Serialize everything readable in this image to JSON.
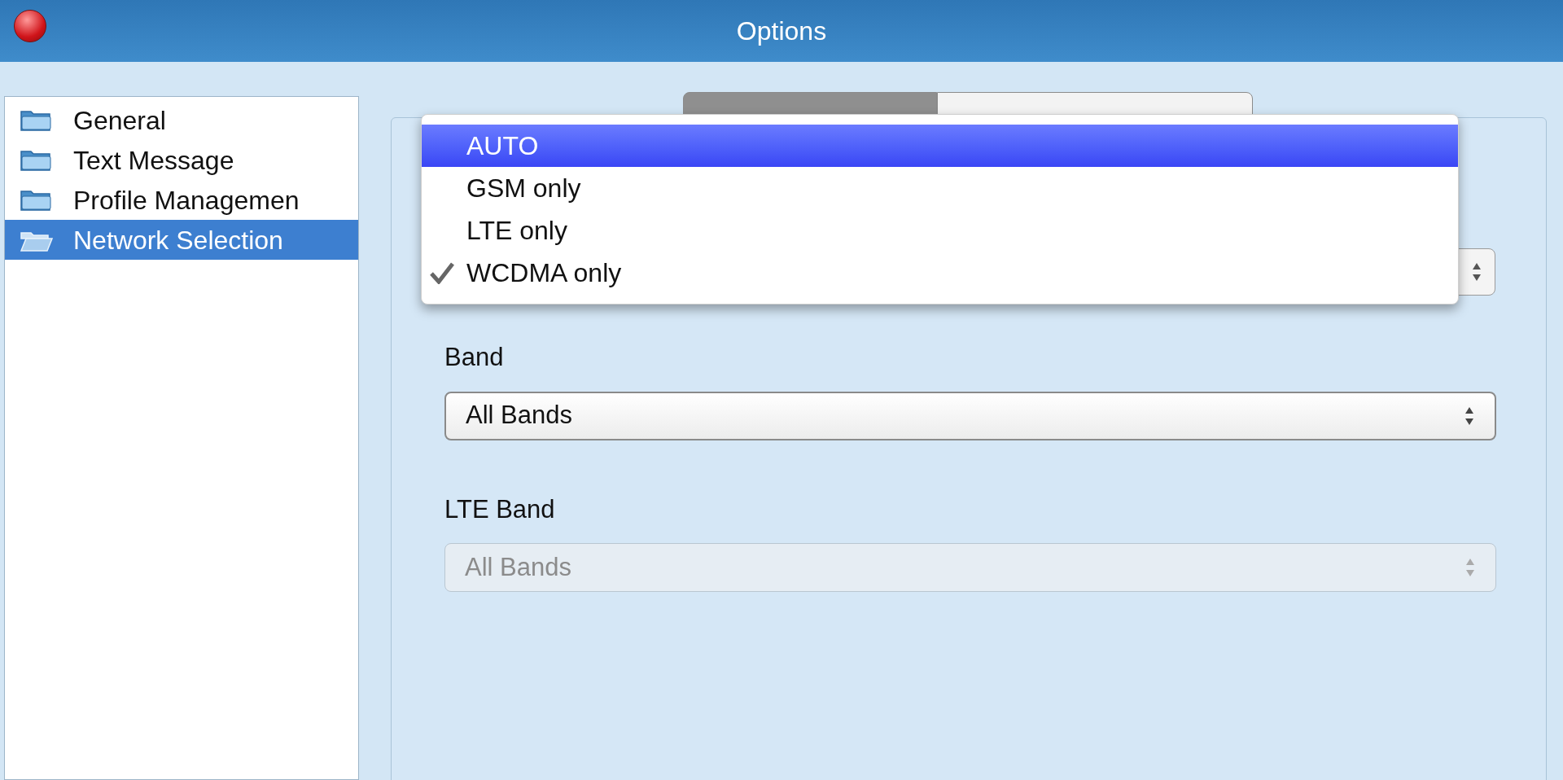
{
  "window": {
    "title": "Options"
  },
  "sidebar": {
    "items": [
      {
        "label": "General",
        "selected": false
      },
      {
        "label": "Text Message",
        "selected": false
      },
      {
        "label": "Profile Managemen",
        "selected": false
      },
      {
        "label": "Network Selection",
        "selected": true
      }
    ]
  },
  "tabs": [
    {
      "selected": true
    },
    {
      "selected": false
    }
  ],
  "network_menu": {
    "items": [
      {
        "label": "AUTO",
        "highlighted": true,
        "checked": false
      },
      {
        "label": "GSM only",
        "highlighted": false,
        "checked": false
      },
      {
        "label": "LTE only",
        "highlighted": false,
        "checked": false
      },
      {
        "label": "WCDMA only",
        "highlighted": false,
        "checked": true
      }
    ]
  },
  "fields": [
    {
      "label": "Band",
      "value": "All Bands",
      "disabled": false
    },
    {
      "label": "LTE Band",
      "value": "All Bands",
      "disabled": true
    }
  ]
}
